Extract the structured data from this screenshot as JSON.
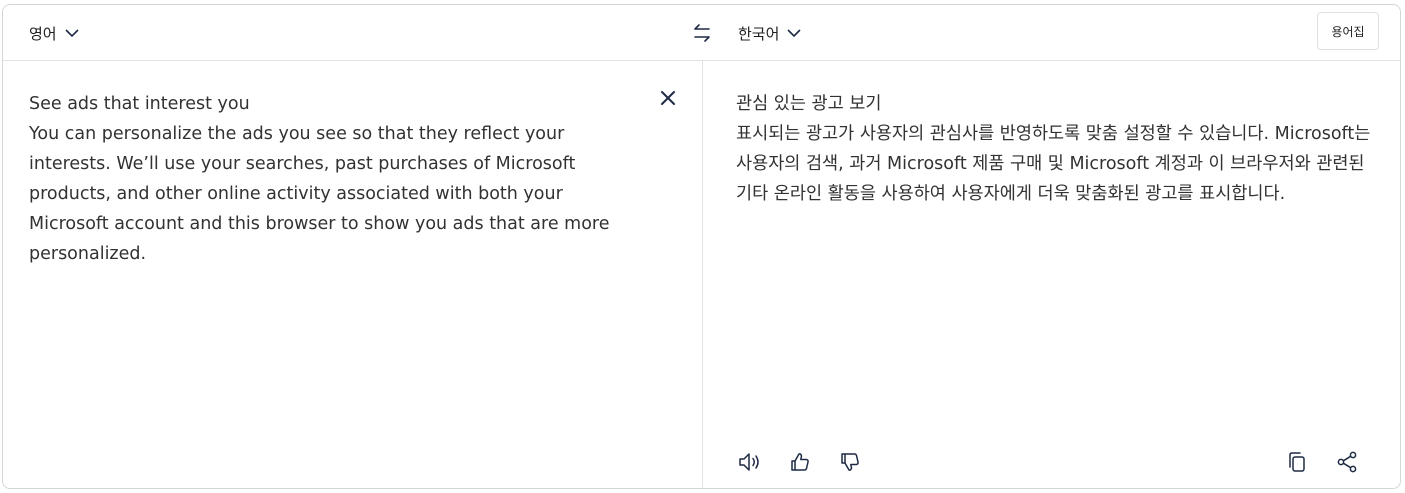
{
  "source": {
    "language": "영어",
    "text": "See ads that interest you\nYou can personalize the ads you see so that they reflect your interests. We’ll use your searches, past purchases of Microsoft products, and other online activity associated with both your Microsoft account and this browser to show you ads that are more personalized."
  },
  "target": {
    "language": "한국어",
    "text": "관심 있는 광고 보기\n표시되는 광고가 사용자의 관심사를 반영하도록 맞춤 설정할 수 있습니다. Microsoft는 사용자의 검색, 과거 Microsoft 제품 구매 및 Microsoft 계정과 이 브라우저와 관련된 기타 온라인 활동을 사용하여 사용자에게 더욱 맞춤화된 광고를 표시합니다."
  },
  "toolbar": {
    "glossary_label": "용어집"
  },
  "icons": {
    "swap": "swap-arrows-icon",
    "clear": "close-icon",
    "listen": "speaker-icon",
    "like": "thumbs-up-icon",
    "dislike": "thumbs-down-icon",
    "copy": "copy-icon",
    "share": "share-icon"
  },
  "colors": {
    "icon": "#1f2a44",
    "border": "#d6d6d6",
    "text": "#323232"
  }
}
